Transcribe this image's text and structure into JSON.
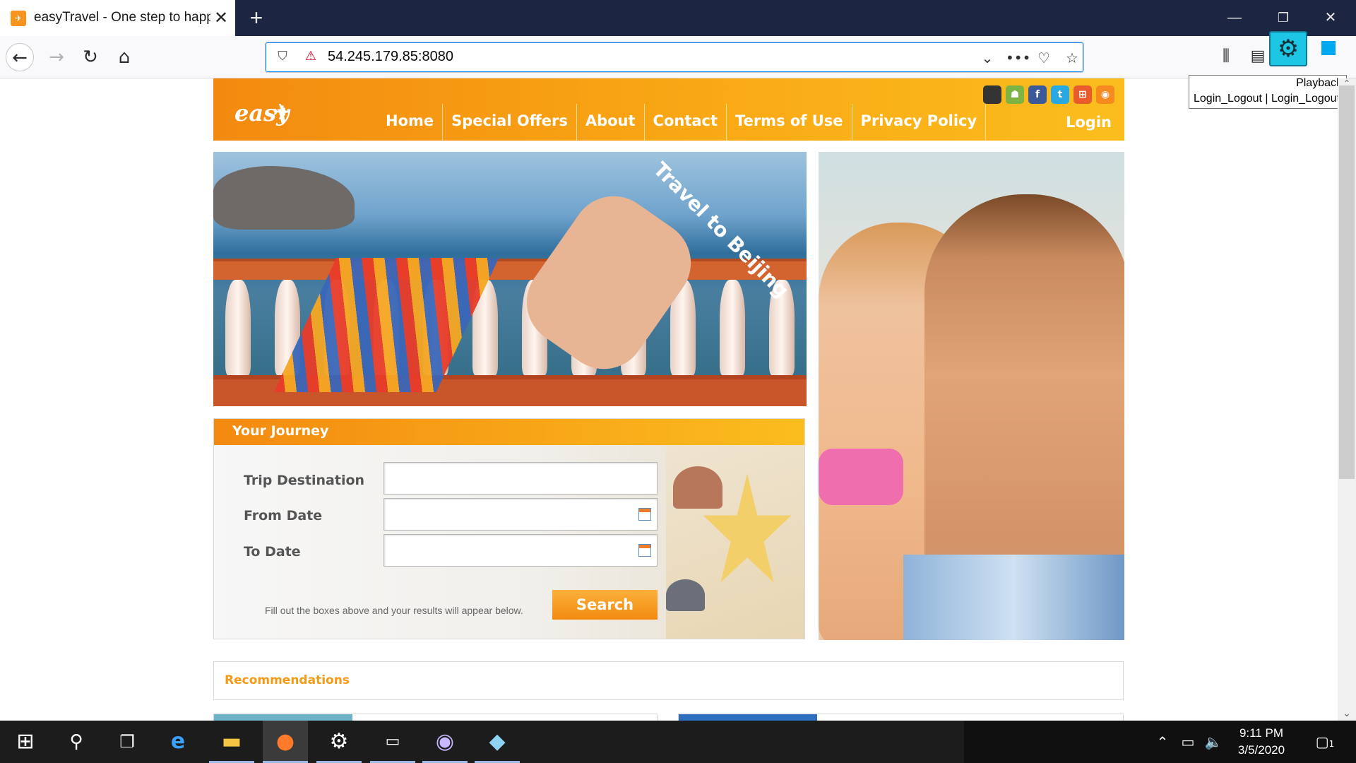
{
  "browser": {
    "tab_title": "easyTravel - One step to happiness",
    "tab_favicon": "paper-plane-icon",
    "new_tab_symbol": "+",
    "close_tab_symbol": "✕",
    "url": "54.245.179.85:8080",
    "window_controls": {
      "minimize": "—",
      "restore": "❐",
      "close": "✕"
    },
    "tooltip": {
      "line1": "Playback",
      "line2": "Login_Logout | Login_Logout"
    }
  },
  "site": {
    "logo_text": "easy Travel",
    "menu": [
      "Home",
      "Special Offers",
      "About",
      "Contact",
      "Terms of Use",
      "Privacy Policy"
    ],
    "login_label": "Login",
    "social_icons": [
      {
        "name": "apple-icon",
        "glyph": "",
        "color": "#333333"
      },
      {
        "name": "android-icon",
        "glyph": "☗",
        "color": "#7cb342"
      },
      {
        "name": "facebook-icon",
        "glyph": "f",
        "color": "#3b5998"
      },
      {
        "name": "twitter-icon",
        "glyph": "t",
        "color": "#29a9e1"
      },
      {
        "name": "windows-icon",
        "glyph": "⊞",
        "color": "#e95b2b"
      },
      {
        "name": "rss-icon",
        "glyph": "◉",
        "color": "#f68a1e"
      }
    ],
    "hero_banner": "Travel to Beijing",
    "journey": {
      "title": "Your Journey",
      "trip_destination_label": "Trip Destination",
      "from_date_label": "From Date",
      "to_date_label": "To Date",
      "trip_destination_value": "",
      "from_date_value": "",
      "to_date_value": "",
      "hint": "Fill out the boxes above and your results will appear below.",
      "search_label": "Search"
    },
    "recommendations_title": "Recommendations"
  },
  "colors": {
    "brand_orange": "#f38a10",
    "brand_yellow": "#fbbd1e",
    "recommendations_text": "#f39a16"
  },
  "taskbar": {
    "apps": [
      "windows-start-icon",
      "search-icon",
      "task-view-icon",
      "internet-explorer-icon",
      "file-explorer-icon",
      "firefox-icon",
      "settings-gear-icon",
      "terminal-icon",
      "github-icon",
      "notes-icon"
    ],
    "time": "9:11 PM",
    "date": "3/5/2020",
    "notification_count": "1"
  }
}
